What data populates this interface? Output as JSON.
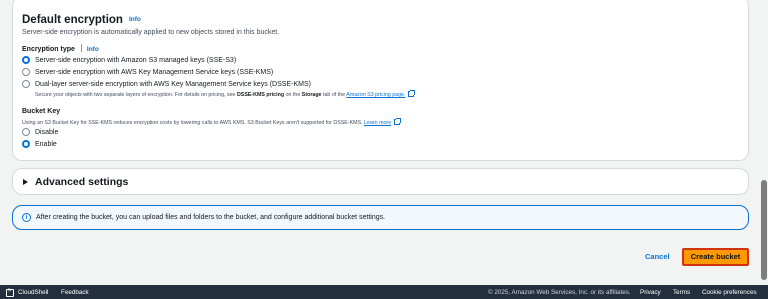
{
  "encryption": {
    "title": "Default encryption",
    "info": "Info",
    "description": "Server-side encryption is automatically applied to new objects stored in this bucket.",
    "type_label": "Encryption type",
    "type_info": "Info",
    "options": [
      {
        "label": "Server-side encryption with Amazon S3 managed keys (SSE-S3)",
        "selected": true
      },
      {
        "label": "Server-side encryption with AWS Key Management Service keys (SSE-KMS)",
        "selected": false
      },
      {
        "label": "Dual-layer server-side encryption with AWS Key Management Service keys (DSSE-KMS)",
        "selected": false
      }
    ],
    "dsse_sub_1": "Secure your objects with two separate layers of encryption. For details on pricing, see",
    "dsse_sub_bold1": "DSSE-KMS pricing",
    "dsse_sub_2": "on the",
    "dsse_sub_bold2": "Storage",
    "dsse_sub_3": "tab of the",
    "dsse_sub_link": "Amazon S3 pricing page."
  },
  "bucket_key": {
    "label": "Bucket Key",
    "description": "Using an S3 Bucket Key for SSE-KMS reduces encryption costs by lowering calls to AWS KMS. S3 Bucket Keys aren't supported for DSSE-KMS.",
    "learn_more": "Learn more",
    "options": [
      {
        "label": "Disable",
        "selected": false
      },
      {
        "label": "Enable",
        "selected": true
      }
    ]
  },
  "advanced": {
    "title": "Advanced settings"
  },
  "alert": {
    "text": "After creating the bucket, you can upload files and folders to the bucket, and configure additional bucket settings."
  },
  "actions": {
    "cancel": "Cancel",
    "create": "Create bucket"
  },
  "footer": {
    "cloudshell": "CloudShell",
    "feedback": "Feedback",
    "copyright": "© 2025, Amazon Web Services, Inc. or its affiliates.",
    "privacy": "Privacy",
    "terms": "Terms",
    "cookies": "Cookie preferences"
  }
}
